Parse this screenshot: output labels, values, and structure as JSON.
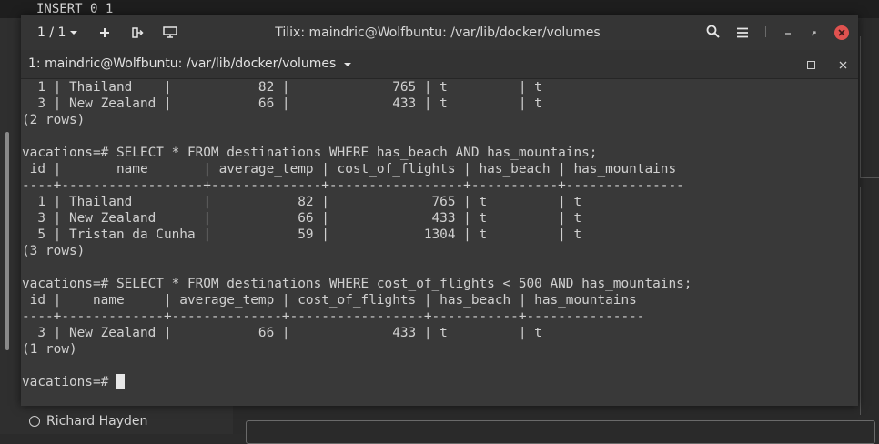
{
  "background": {
    "terminal_top_line": "INSERT 0 1",
    "contact_name": "Richard Hayden"
  },
  "window": {
    "session_label": "1 / 1",
    "title": "Tilix: maindric@Wolfbuntu: /var/lib/docker/volumes",
    "tab_title": "1: maindric@Wolfbuntu: /var/lib/docker/volumes"
  },
  "terminal": {
    "lines": [
      "  1 | Thailand    |           82 |             765 | t         | t",
      "  3 | New Zealand |           66 |             433 | t         | t",
      "(2 rows)",
      "",
      "vacations=# SELECT * FROM destinations WHERE has_beach AND has_mountains;",
      " id |       name       | average_temp | cost_of_flights | has_beach | has_mountains",
      "----+------------------+--------------+-----------------+-----------+---------------",
      "  1 | Thailand         |           82 |             765 | t         | t",
      "  3 | New Zealand      |           66 |             433 | t         | t",
      "  5 | Tristan da Cunha |           59 |            1304 | t         | t",
      "(3 rows)",
      "",
      "vacations=# SELECT * FROM destinations WHERE cost_of_flights < 500 AND has_mountains;",
      " id |    name     | average_temp | cost_of_flights | has_beach | has_mountains",
      "----+-------------+--------------+-----------------+-----------+---------------",
      "  3 | New Zealand |           66 |             433 | t         | t",
      "(1 row)",
      ""
    ],
    "prompt": "vacations=# "
  }
}
